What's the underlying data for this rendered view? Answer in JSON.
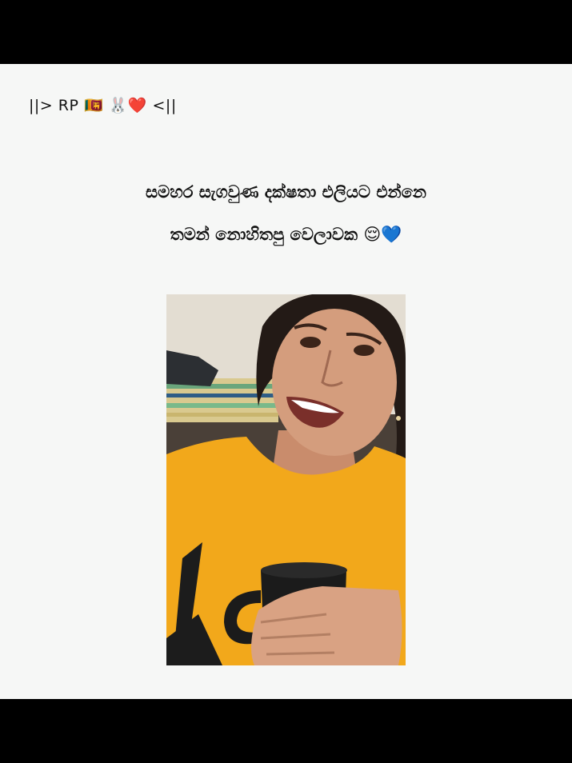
{
  "post": {
    "handle": "||> RP 🇱🇰 🐰❤️ <||",
    "caption_line1": "සමහර සැගවුණ දක්ෂතා එලියට එන්නෙ",
    "caption_line2": "තමන් නොහිතපු වෙලාවක 😌💙"
  },
  "media": {
    "icon": "woman-holding-mug-photo"
  },
  "colors": {
    "background": "#f6f7f6",
    "bars": "#000000",
    "shirt": "#f2a81b"
  }
}
